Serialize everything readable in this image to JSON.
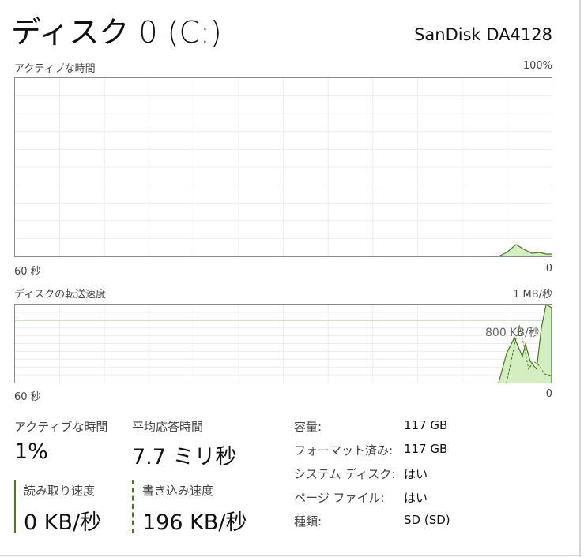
{
  "header": {
    "title": "ディスク 0 (C:)",
    "model": "SanDisk DA4128"
  },
  "active_time_graph": {
    "label": "アクティブな時間",
    "max_label": "100%",
    "time_label": "60 秒",
    "min_label": "0"
  },
  "transfer_graph": {
    "label": "ディスクの転送速度",
    "max_label": "1 MB/秒",
    "ref_label": "800 KB/秒",
    "time_label": "60 秒",
    "min_label": "0"
  },
  "stats": {
    "active_time": {
      "label": "アクティブな時間",
      "value": "1%"
    },
    "avg_response": {
      "label": "平均応答時間",
      "value": "7.7 ミリ秒"
    },
    "read_speed": {
      "label": "読み取り速度",
      "value": "0 KB/秒"
    },
    "write_speed": {
      "label": "書き込み速度",
      "value": "196 KB/秒"
    }
  },
  "properties": [
    {
      "key": "容量:",
      "value": "117 GB"
    },
    {
      "key": "フォーマット済み:",
      "value": "117 GB"
    },
    {
      "key": "システム ディスク:",
      "value": "はい"
    },
    {
      "key": "ページ ファイル:",
      "value": "はい"
    },
    {
      "key": "種類:",
      "value": "SD (SD)"
    }
  ],
  "colors": {
    "accent": "#4c7a1e",
    "fill": "#d3eec0",
    "grid": "#ececec",
    "border": "#8a8a8a"
  }
}
